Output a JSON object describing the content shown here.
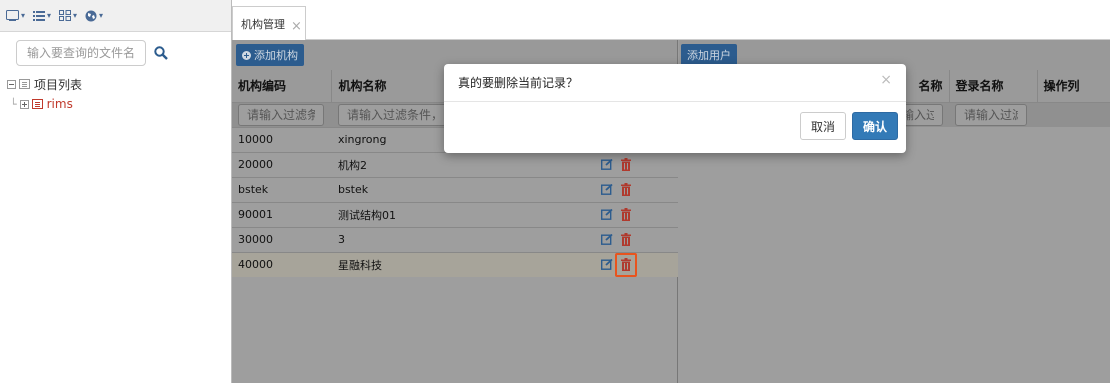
{
  "toolbar": {
    "icons": [
      "window-icon",
      "list-icon",
      "grid-icon",
      "globe-icon"
    ],
    "caret": "▾"
  },
  "left": {
    "search_placeholder": "输入要查询的文件名...",
    "tree": [
      {
        "label": "项目列表",
        "expanded": true,
        "highlight": false
      },
      {
        "label": "rims",
        "expanded": false,
        "highlight": true
      }
    ]
  },
  "tabs": [
    {
      "label": "机构管理",
      "close": "×"
    }
  ],
  "org": {
    "add_button": "添加机构",
    "columns": [
      "机构编码",
      "机构名称",
      ""
    ],
    "filter_placeholders": [
      "请输入过滤条件",
      "请输入过滤条件，回"
    ],
    "rows": [
      {
        "code": "10000",
        "name": "xingrong"
      },
      {
        "code": "20000",
        "name": "机构2"
      },
      {
        "code": "bstek",
        "name": "bstek"
      },
      {
        "code": "90001",
        "name": "测试结构01"
      },
      {
        "code": "30000",
        "name": "3"
      },
      {
        "code": "40000",
        "name": "星融科技"
      }
    ]
  },
  "user": {
    "add_button": "添加用户",
    "columns": [
      "名称",
      "登录名称",
      "操作列"
    ],
    "filter_placeholders": [
      "输入过滤",
      "请输入过滤"
    ]
  },
  "modal": {
    "message": "真的要删除当前记录？",
    "close": "×",
    "cancel": "取消",
    "confirm": "确认"
  },
  "colors": {
    "primary": "#337ab7",
    "danger": "#c0392b",
    "highlight_border": "#e8541e"
  }
}
